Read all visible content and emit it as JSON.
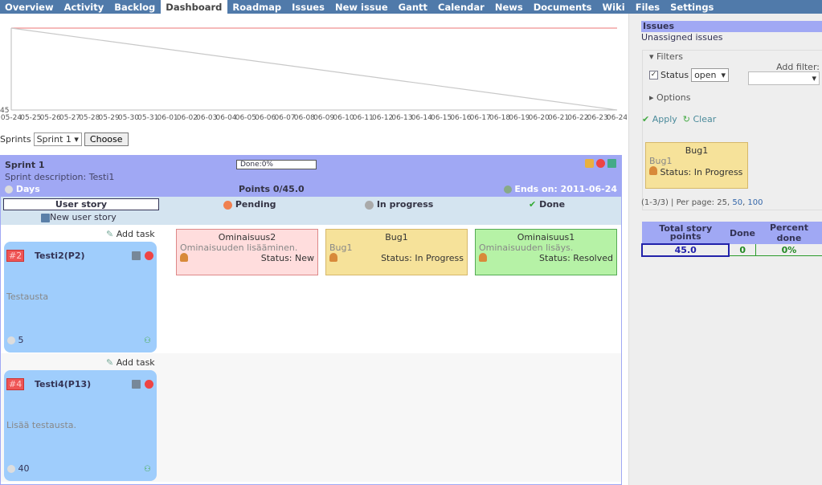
{
  "nav": {
    "items": [
      "Overview",
      "Activity",
      "Backlog",
      "Dashboard",
      "Roadmap",
      "Issues",
      "New issue",
      "Gantt",
      "Calendar",
      "News",
      "Documents",
      "Wiki",
      "Files",
      "Settings"
    ],
    "selected": "Dashboard"
  },
  "chart_data": {
    "type": "line",
    "y_tick": "45",
    "ylim": [
      0,
      45
    ],
    "x": [
      "05-24",
      "05-25",
      "05-26",
      "05-27",
      "05-28",
      "05-29",
      "05-30",
      "05-31",
      "06-01",
      "06-02",
      "06-03",
      "06-04",
      "06-05",
      "06-06",
      "06-07",
      "06-08",
      "06-09",
      "06-10",
      "06-11",
      "06-12",
      "06-13",
      "06-14",
      "06-15",
      "06-16",
      "06-17",
      "06-18",
      "06-19",
      "06-20",
      "06-21",
      "06-22",
      "06-23",
      "06-24"
    ],
    "series": [
      {
        "color": "#f09090",
        "values": "constant 45",
        "start": 45,
        "end": 45
      },
      {
        "color": "#c8c8c8",
        "start": 45,
        "end": 0
      }
    ]
  },
  "sprints": {
    "label": "Sprints",
    "selected": "Sprint 1",
    "choose": "Choose"
  },
  "sprint": {
    "name": "Sprint 1",
    "description": "Sprint description: Testi1",
    "done": "Done:0%",
    "done_percent": 0,
    "days": "Days",
    "points": "Points 0/45.0",
    "ends": "Ends on: 2011-06-24"
  },
  "columns": {
    "user_story": "User story",
    "new_user_story": "New user story",
    "pending": "Pending",
    "in_progress": "In progress",
    "done": "Done"
  },
  "stories": [
    {
      "id": "#2",
      "title": "Testi2(P2)",
      "desc": "Testausta",
      "points": "5",
      "add_task": "Add task"
    },
    {
      "id": "#4",
      "title": "Testi4(P13)",
      "desc": "Lisää testausta.",
      "points": "40",
      "add_task": "Add task"
    }
  ],
  "tasks": [
    {
      "title": "Ominaisuus2",
      "desc": "Ominaisuuden lisääminen.",
      "status": "Status: New"
    },
    {
      "title": "Bug1",
      "desc": "Bug1",
      "status": "Status: In Progress"
    },
    {
      "title": "Ominaisuus1",
      "desc": "Ominaisuuden lisäys.",
      "status": "Status: Resolved"
    }
  ],
  "side": {
    "title": "Issues",
    "subtitle": "Unassigned issues",
    "filters": "Filters",
    "status_label": "Status",
    "status_value": "open",
    "add_filter": "Add filter:",
    "options": "Options",
    "apply": "Apply",
    "clear": "Clear",
    "card": {
      "title": "Bug1",
      "desc": "Bug1",
      "status": "Status: In Progress"
    },
    "pagination": "(1-3/3) | Per page: ",
    "per_page": [
      "25",
      "50",
      "100"
    ],
    "stats": {
      "headers": [
        "Total story points",
        "Done",
        "Percent done"
      ],
      "values": [
        "45.0",
        "0",
        "0%"
      ]
    }
  }
}
